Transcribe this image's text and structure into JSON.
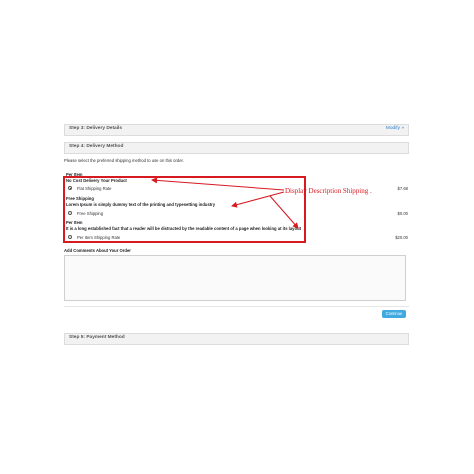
{
  "steps": {
    "step3_title": "Step 3: Delivery Details",
    "step3_modify": "Modify »",
    "step4_title": "Step 4: Delivery Method",
    "step5_title": "Step 5: Payment Method"
  },
  "intro_text": "Please select the preferred shipping method to use on this order.",
  "methods": [
    {
      "group_title": "Per Item",
      "description": "No Cost Delivery Your Product",
      "option_label": "Flat Shipping Rate",
      "price": "$7.68",
      "selected": true
    },
    {
      "group_title": "Free Shipping",
      "description": "Lorem Ipsum is simply dummy text of the printing and typesetting industry",
      "option_label": "Free Shipping",
      "price": "$0.00",
      "selected": false
    },
    {
      "group_title": "Per Item",
      "description": "It is a long established fact that a reader will be distracted by the readable content of a page when looking at its layout",
      "option_label": "Per Item Shipping Rate",
      "price": "$20.00",
      "selected": false
    }
  ],
  "annotation": "Display Description Shipping .",
  "comments_label": "Add Comments About Your Order",
  "continue_label": "Continue",
  "colors": {
    "annotation_red": "#d71920",
    "button_blue": "#3fa9e0"
  }
}
